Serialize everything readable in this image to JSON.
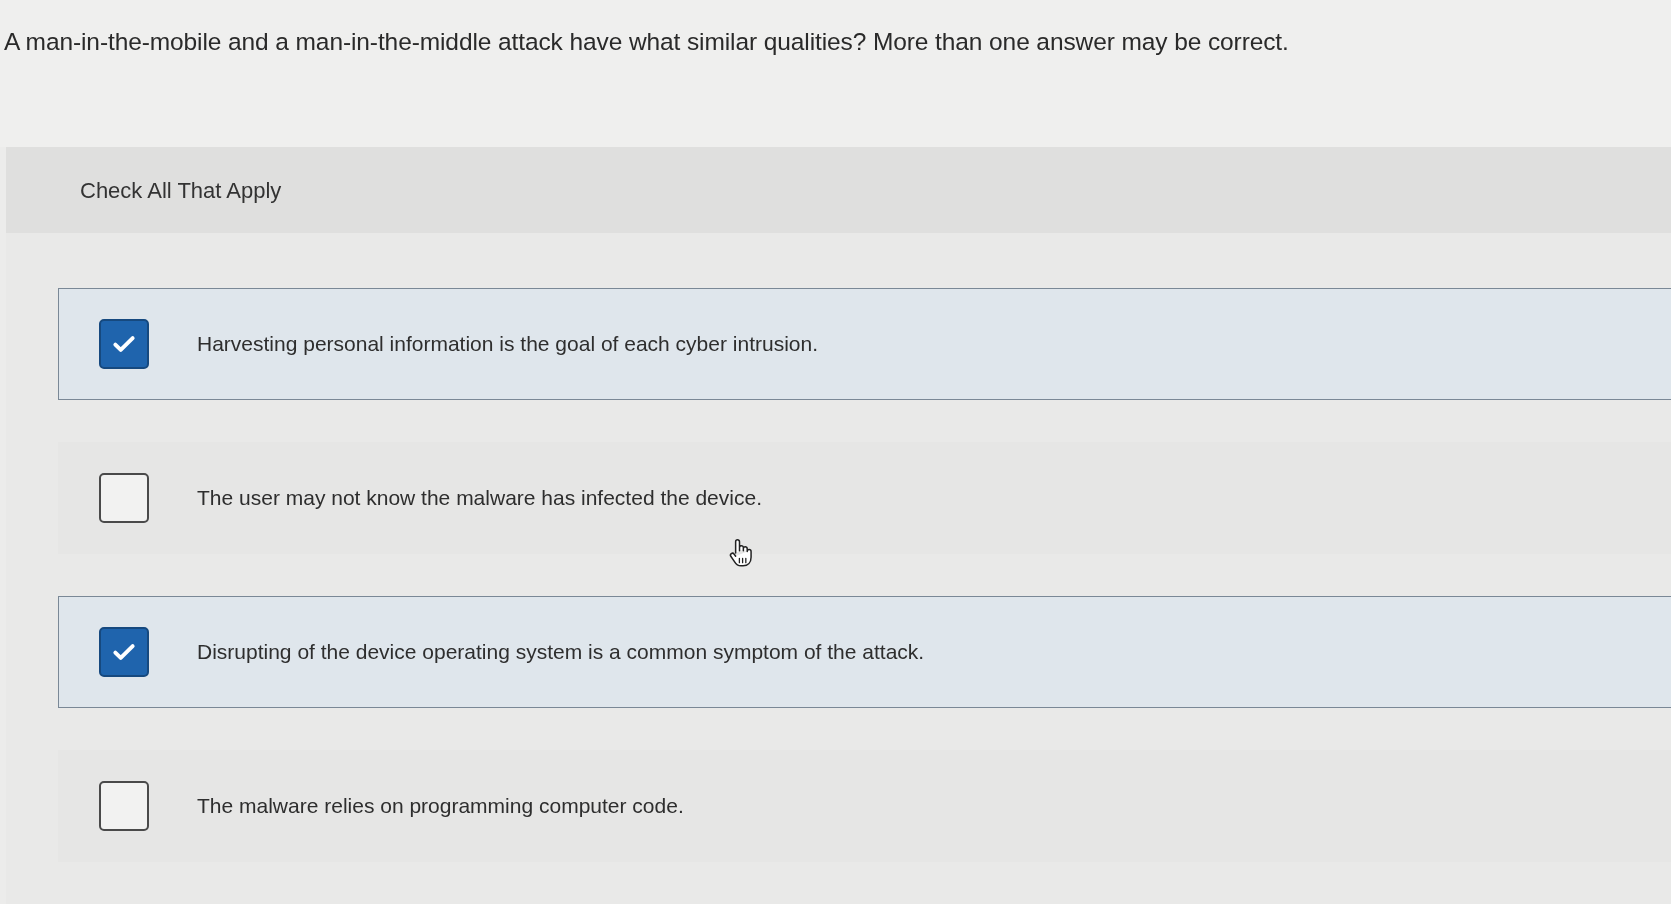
{
  "question": "A man-in-the-mobile and a man-in-the-middle attack have what similar qualities? More than one answer may be correct.",
  "instruction": "Check All That Apply",
  "options": [
    {
      "text": "Harvesting personal information is the goal of each cyber intrusion.",
      "checked": true
    },
    {
      "text": "The user may not know the malware has infected the device.",
      "checked": false
    },
    {
      "text": "Disrupting of the device operating system is a common symptom of the attack.",
      "checked": true
    },
    {
      "text": "The malware relies on programming computer code.",
      "checked": false
    }
  ]
}
